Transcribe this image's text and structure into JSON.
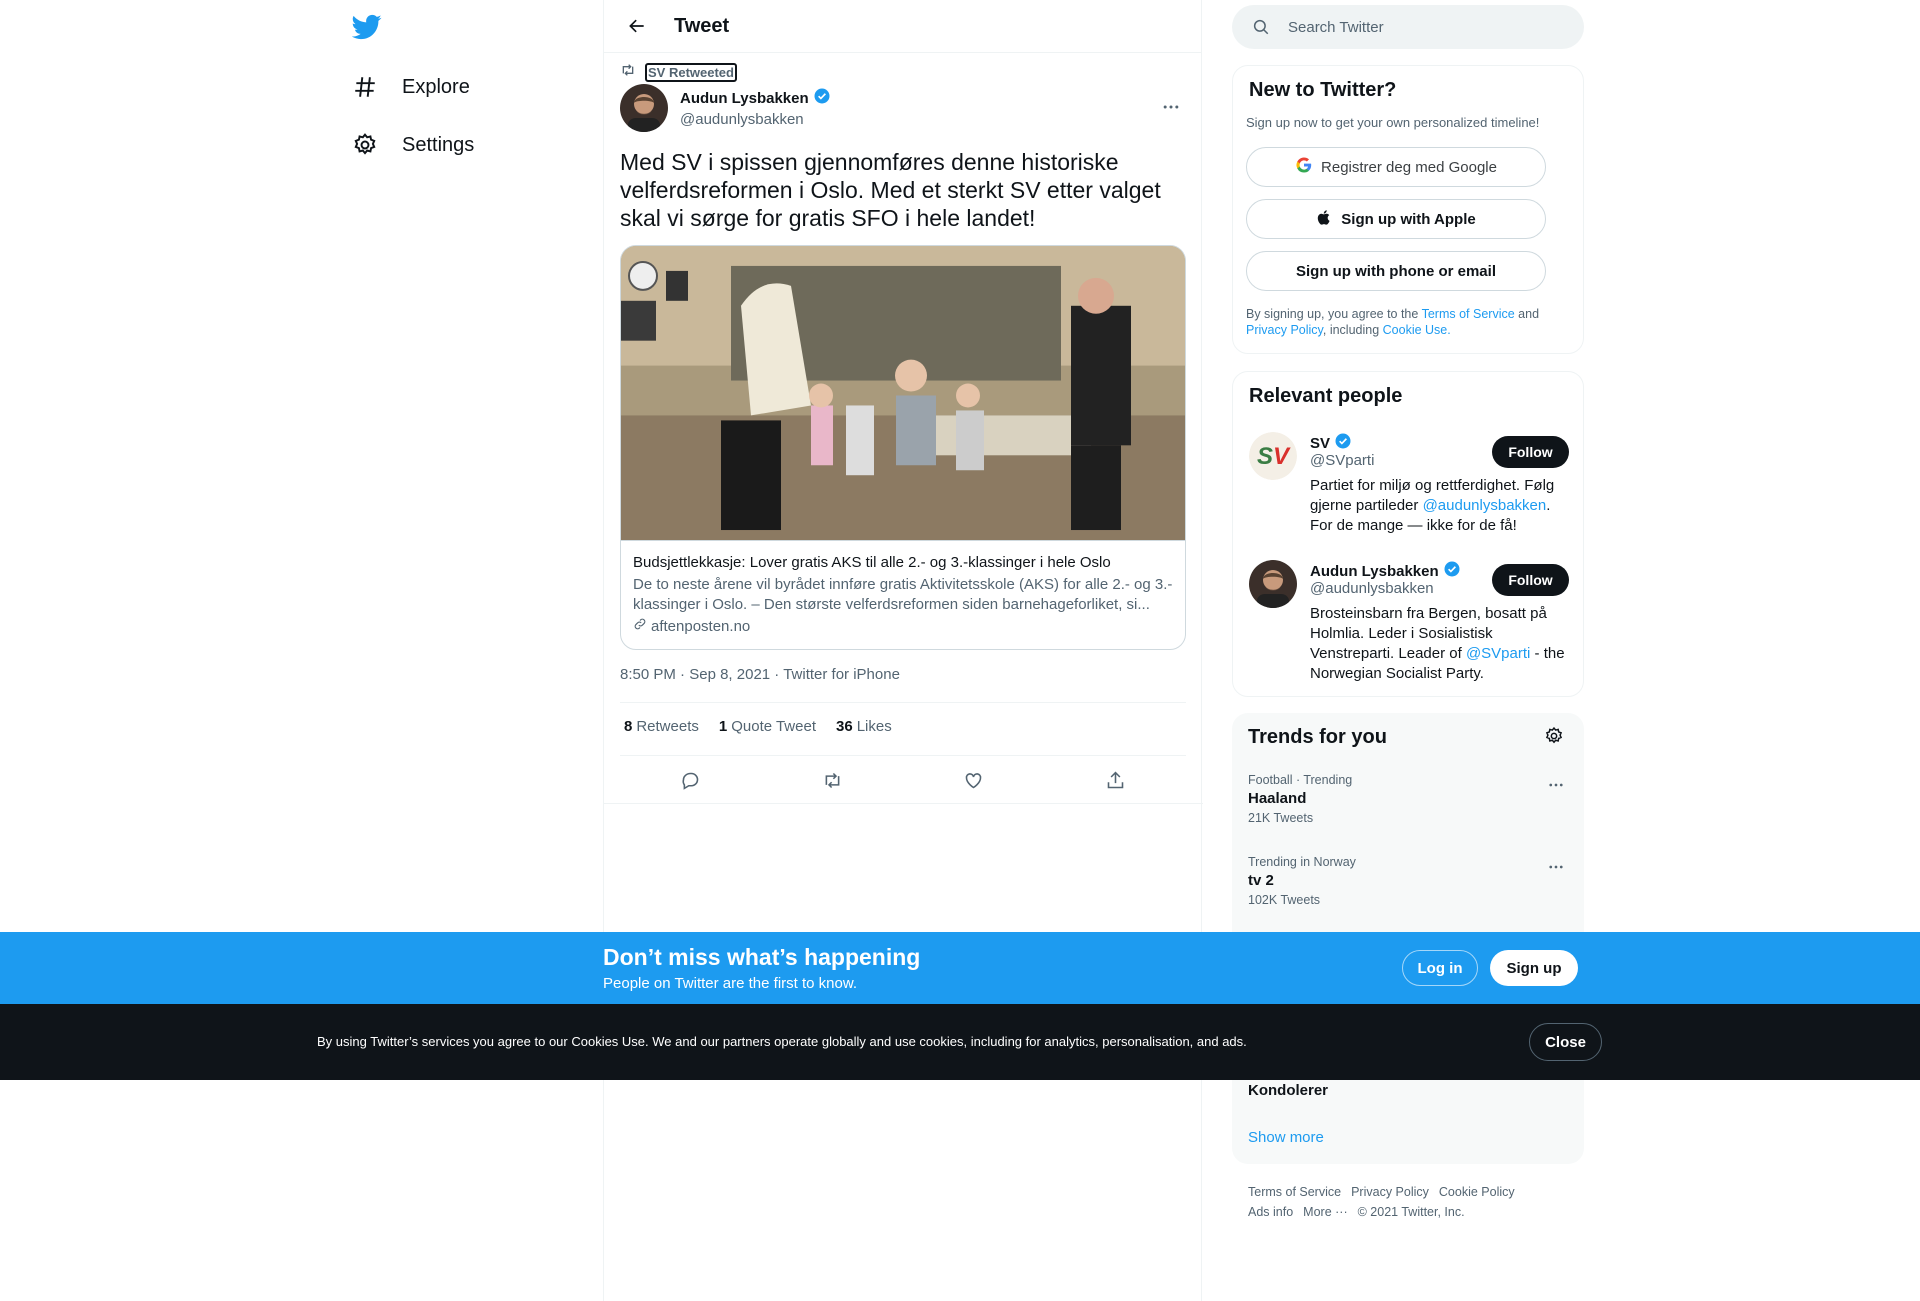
{
  "nav": {
    "logo_icon": "twitter-bird-icon",
    "items": [
      {
        "label": "Explore",
        "icon": "hashtag-icon"
      },
      {
        "label": "Settings",
        "icon": "gear-icon"
      }
    ]
  },
  "header": {
    "title": "Tweet"
  },
  "tweet": {
    "retweeted_by": "SV Retweeted",
    "author_name": "Audun Lysbakken",
    "author_handle": "@audunlysbakken",
    "verified": true,
    "text": "Med SV i spissen gjennomføres denne historiske velferdsreformen i Oslo. Med et sterkt SV etter valget skal vi sørge for gratis SFO i hele landet!",
    "card": {
      "title": "Budsjettlekkasje: Lover gratis AKS til alle 2.- og 3.-klassinger i hele Oslo",
      "description": "De to neste årene vil byrådet innføre gratis Aktivitetsskole (AKS) for alle 2.- og 3.-klassinger i Oslo. – Den største velferdsreformen siden barnehageforliket, si...",
      "domain": "aftenposten.no"
    },
    "time": "8:50 PM",
    "date": "Sep 8, 2021",
    "client": "Twitter for iPhone",
    "stats": {
      "retweets_count": "8",
      "retweets_label": "Retweets",
      "quotes_count": "1",
      "quotes_label": "Quote Tweet",
      "likes_count": "36",
      "likes_label": "Likes"
    }
  },
  "search": {
    "placeholder": "Search Twitter"
  },
  "new_to_twitter": {
    "title": "New to Twitter?",
    "subtitle": "Sign up now to get your own personalized timeline!",
    "google_label": "Registrer deg med Google",
    "apple_label": "Sign up with Apple",
    "phone_label": "Sign up with phone or email",
    "legal_prefix": "By signing up, you agree to the ",
    "terms": "Terms of Service",
    "and": " and ",
    "privacy": "Privacy Policy",
    "including": ", including ",
    "cookie": "Cookie Use."
  },
  "relevant_people": {
    "title": "Relevant people",
    "people": [
      {
        "name": "SV",
        "handle": "@SVparti",
        "bio_a": "Partiet for miljø og rettferdighet. Følg gjerne partileder ",
        "bio_link": "@audunlysbakken",
        "bio_b": ". For de mange — ikke for de få!",
        "follow": "Follow"
      },
      {
        "name": "Audun Lysbakken",
        "handle": "@audunlysbakken",
        "bio_a": "Brosteinsbarn fra Bergen, bosatt på Holmlia. Leder i Sosialistisk Venstreparti. Leader of ",
        "bio_link": "@SVparti",
        "bio_b": " - the Norwegian Socialist Party.",
        "follow": "Follow"
      }
    ]
  },
  "trends": {
    "title": "Trends for you",
    "items": [
      {
        "meta": "Football · Trending",
        "name": "Haaland",
        "count": "21K Tweets"
      },
      {
        "meta": "Trending in Norway",
        "name": "tv 2",
        "count": "102K Tweets"
      },
      {
        "name": "Kondolerer"
      }
    ],
    "show_more": "Show more"
  },
  "footer": {
    "links": [
      "Terms of Service",
      "Privacy Policy",
      "Cookie Policy",
      "Ads info",
      "More ···"
    ],
    "copyright": "© 2021 Twitter, Inc."
  },
  "banner": {
    "title": "Don’t miss what’s happening",
    "subtitle": "People on Twitter are the first to know.",
    "login": "Log in",
    "signup": "Sign up"
  },
  "cookie_bar": {
    "text": "By using Twitter’s services you agree to our Cookies Use. We and our partners operate globally and use cookies, including for analytics, personalisation, and ads.",
    "close": "Close"
  },
  "colors": {
    "accent": "#1d9bf0",
    "dark": "#0f1419",
    "muted": "#536471"
  }
}
